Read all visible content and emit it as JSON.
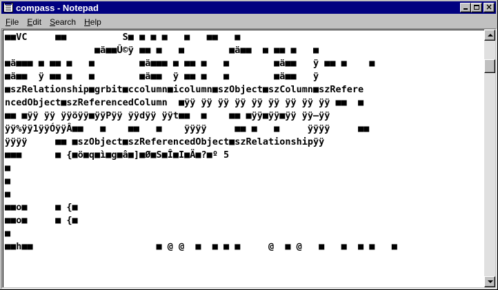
{
  "window": {
    "title": "compass - Notepad",
    "icon": "notepad-icon",
    "controls": {
      "minimize": "minimize-icon",
      "maximize": "maximize-icon",
      "close": "×"
    }
  },
  "menu": {
    "file": {
      "mnemonic": "F",
      "rest": "ile"
    },
    "edit": {
      "mnemonic": "E",
      "rest": "dit"
    },
    "search": {
      "mnemonic": "S",
      "rest": "earch"
    },
    "help": {
      "mnemonic": "H",
      "rest": "elp"
    }
  },
  "document": {
    "lines": [
      "■■VC     ■■          S■ ■ ■ ■   ■   ■■   ■",
      "                ■ä■■Û©ÿ ■■ ■   ■        ■ä■■  ■ ■■ ■   ■",
      "■ä■■■ ■ ■■ ■   ■        ■ä■■■ ■ ■■ ■   ■        ■ä■■   ÿ ■■ ■    ■",
      "■ä■■  ÿ ■■ ■   ■        ■ä■■  ÿ ■■ ■   ■        ■ä■■   ÿ",
      "■szRelationship■grbit■ccolumn■icolumn■szObject■szColumn■szRefere",
      "ncedObject■szReferencedColumn  ■ÿÿ ÿÿ ÿÿ ÿÿ ÿÿ ÿÿ ÿÿ ÿÿ ÿÿ ■■  ■",
      "■■ ■ÿÿ ÿÿ ÿÿöÿÿ■ÿÿPÿÿ ÿÿdÿÿ ÿÿt■■  ■    ■■ ■ÿÿ■ÿÿ■ÿÿ ÿÿ–ÿÿ",
      "ÿÿ%ÿÿ1ÿÿÓÿÿÂ■■   ■    ■■   ■    ÿÿÿÿ     ■■ ■   ■     ÿÿÿÿ     ■■",
      "ÿÿÿÿ     ■■ ■szObject■szReferencedObject■szRelationshipÿÿ",
      "■■■      ■ {■ö■q■ì■g■â■]■Ø■S■Î■I■Ä■?■º 5",
      "■",
      "■",
      "■",
      "■■o■     ■ {■",
      "■■o■     ■ {■",
      "■",
      "■■h■■                      ■ @ @  ■  ■ ■ ■     @  ■ @   ■   ■  ■ ■   ■"
    ]
  }
}
